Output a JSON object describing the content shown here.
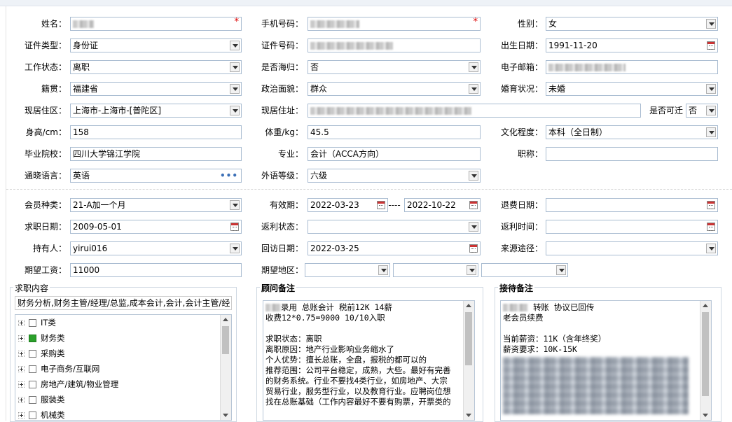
{
  "personal": {
    "name_label": "姓名：",
    "phone_label": "手机号码：",
    "gender_label": "性别：",
    "gender_value": "女",
    "id_type_label": "证件类型：",
    "id_type_value": "身份证",
    "id_number_label": "证件号码：",
    "birth_label": "出生日期：",
    "birth_value": "1991-11-20",
    "work_status_label": "工作状态：",
    "work_status_value": "离职",
    "overseas_label": "是否海归：",
    "overseas_value": "否",
    "email_label": "电子邮箱：",
    "native_label": "籍贯：",
    "native_value": "福建省",
    "political_label": "政治面貌：",
    "political_value": "群众",
    "marital_label": "婚育状况：",
    "marital_value": "未婚",
    "residence_label": "现居住区：",
    "residence_value": "上海市-上海市-[普陀区]",
    "address_label": "现居住址：",
    "relocate_label": "是否可迁",
    "relocate_value": "否",
    "height_label": "身高/cm：",
    "height_value": "158",
    "weight_label": "体重/kg：",
    "weight_value": "45.5",
    "education_label": "文化程度：",
    "education_value": "本科（全日制）",
    "school_label": "毕业院校：",
    "school_value": "四川大学锦江学院",
    "major_label": "专业：",
    "major_value": "会计（ACCA方向）",
    "title_label": "职称：",
    "title_value": "",
    "language_label": "通晓语言：",
    "language_value": "英语",
    "language_more": "•••",
    "foreign_level_label": "外语等级：",
    "foreign_level_value": "六级"
  },
  "membership": {
    "type_label": "会员种类：",
    "type_value": "21-A加一个月",
    "validity_label": "有效期：",
    "validity_from": "2022-03-23",
    "validity_sep": "----",
    "validity_to": "2022-10-22",
    "refund_date_label": "退费日期：",
    "refund_date_value": "",
    "job_date_label": "求职日期：",
    "job_date_value": "2009-05-01",
    "rebate_status_label": "返利状态：",
    "rebate_status_value": "",
    "rebate_time_label": "返利时间：",
    "rebate_time_value": "",
    "holder_label": "持有人：",
    "holder_value": "yirui016",
    "visit_date_label": "回访日期：",
    "visit_date_value": "2022-03-25",
    "source_label": "来源途径：",
    "source_value": "",
    "salary_label": "期望工资：",
    "salary_value": "11000",
    "region_label": "期望地区："
  },
  "job_content": {
    "title": "求职内容",
    "summary": "财务分析,财务主管/经理/总监,成本会计,会计,会计主管/经",
    "tree": [
      {
        "label": "IT类",
        "checked": false
      },
      {
        "label": "财务类",
        "checked": true
      },
      {
        "label": "采购类",
        "checked": false
      },
      {
        "label": "电子商务/互联网",
        "checked": false
      },
      {
        "label": "房地产/建筑/物业管理",
        "checked": false
      },
      {
        "label": "服装类",
        "checked": false
      },
      {
        "label": "机械类",
        "checked": false
      }
    ]
  },
  "consultant_notes": {
    "title": "顾问备注",
    "lines": [
      "录用 总账会计 税前12K 14薪",
      "收费12*0.75=9000 10/10入职",
      "",
      "求职状态：离职",
      "离职原因：地产行业影响业务缩水了",
      "个人优势：擅长总账，全盘，报税的都可以的",
      "推荐范围：公司平台稳定，成熟，大些。最好有完善",
      "的财务系统。行业不要找4类行业，如房地产、大宗",
      "贸易行业，服务型行业，以及教育行业。应聘岗位想",
      "找在总账基础（工作内容最好不要有购票，开票类的"
    ]
  },
  "reception_notes": {
    "title": "接待备注",
    "lines": [
      "转账 协议已回传",
      "老会员续费",
      "",
      "当前薪资：11K（含年终奖）",
      "薪资要求：10K-15K"
    ]
  }
}
